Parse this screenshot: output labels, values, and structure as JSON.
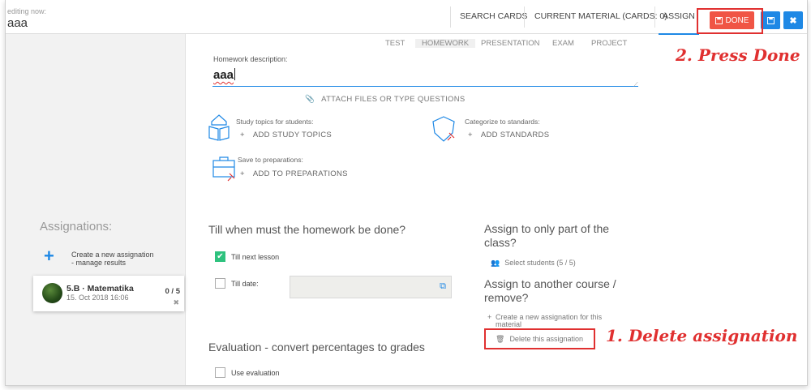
{
  "header": {
    "editing_label": "editing now:",
    "editing_value": "aaa",
    "tabs": [
      {
        "label": "SEARCH CARDS",
        "active": false
      },
      {
        "label": "CURRENT MATERIAL (CARDS: 0)",
        "active": false
      },
      {
        "label": "ASSIGN",
        "active": true
      }
    ],
    "done_label": "DONE",
    "done_icon": "floppy-icon",
    "save_icon": "floppy-icon",
    "close_icon": "close-icon"
  },
  "material_types": [
    "TEST",
    "HOMEWORK",
    "PRESENTATION",
    "EXAM",
    "PROJECT"
  ],
  "active_material_type": "HOMEWORK",
  "homework": {
    "description_label": "Homework description:",
    "description_value": "aaa",
    "attach_label": "ATTACH FILES OR TYPE QUESTIONS",
    "study_topics_label": "Study topics for students:",
    "study_topics_action": "ADD STUDY TOPICS",
    "standards_label": "Categorize to standards:",
    "standards_action": "ADD STANDARDS",
    "preparations_label": "Save to preparations:",
    "preparations_action": "ADD TO PREPARATIONS"
  },
  "sidebar": {
    "title": "Assignations:",
    "create_line1": "Create a new assignation",
    "create_line2": "- manage results",
    "assignment": {
      "class_name": "5.B · Matematika",
      "date": "15. Oct 2018 16:06",
      "count": "0 / 5"
    }
  },
  "deadline": {
    "heading": "Till when must the homework be done?",
    "next_lesson_label": "Till next lesson",
    "next_lesson_checked": true,
    "till_date_label": "Till date:",
    "till_date_checked": false
  },
  "assign_part": {
    "heading_line1": "Assign to only part of the",
    "heading_line2": "class?",
    "select_students": "Select students (5 / 5)"
  },
  "assign_other": {
    "heading_line1": "Assign to another course /",
    "heading_line2": "remove?",
    "create_new_line1": "Create a new assignation for this",
    "create_new_line2": "material",
    "delete_label": "Delete this assignation"
  },
  "evaluation": {
    "heading": "Evaluation - convert percentages to grades",
    "use_label": "Use evaluation",
    "use_checked": false
  },
  "annotations": {
    "step1": "1. Delete assignation",
    "step2": "2. Press Done"
  },
  "colors": {
    "accent": "#1e88e5",
    "done": "#f05545",
    "annotation": "#e03030",
    "check": "#2ec27e"
  }
}
